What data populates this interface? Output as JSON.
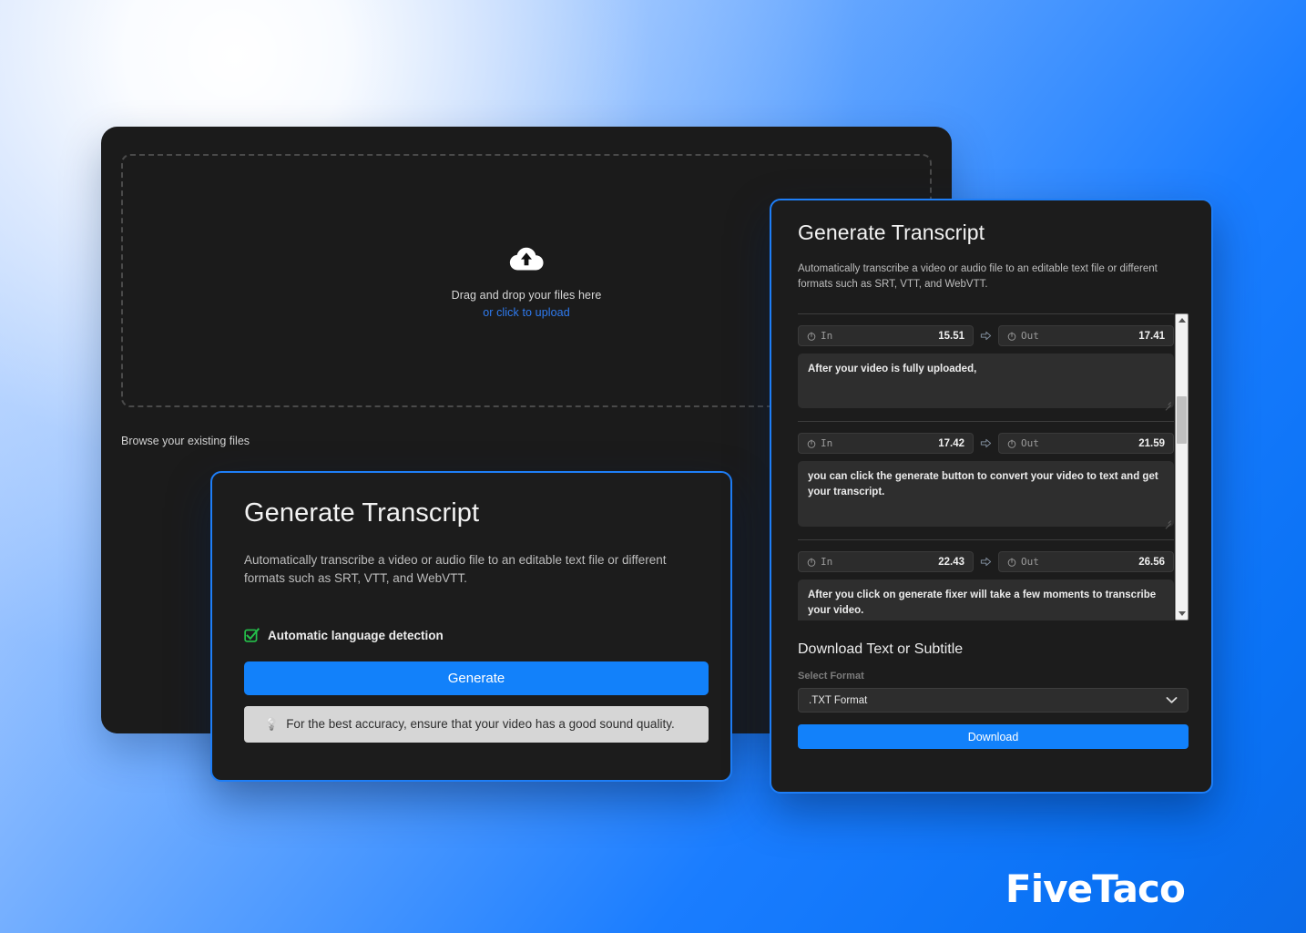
{
  "brand": {
    "name": "FiveTaco"
  },
  "upload_panel": {
    "dropzone": {
      "icon": "cloud-upload-icon",
      "line1": "Drag and drop your files here",
      "link": "or click to upload"
    },
    "browse_label": "Browse your existing files"
  },
  "front_card": {
    "title": "Generate Transcript",
    "description": "Automatically transcribe a video or audio file to an editable text file or different formats such as SRT, VTT, and WebVTT.",
    "auto_language": {
      "icon": "checkbox-checked-icon",
      "label": "Automatic language detection",
      "checked": true
    },
    "generate_label": "Generate",
    "tip": {
      "icon": "lightbulb-icon",
      "text": "For the best accuracy, ensure that your video has a good sound quality."
    },
    "accent_color": "#1281fa",
    "check_color": "#24c04a"
  },
  "right_card": {
    "title": "Generate Transcript",
    "description": "Automatically transcribe a video or audio file to an editable text file or different formats such as SRT, VTT, and WebVTT.",
    "time_labels": {
      "in": "In",
      "out": "Out"
    },
    "segments": [
      {
        "in": "15.51",
        "out": "17.41",
        "text": "After your video is fully uploaded,"
      },
      {
        "in": "17.42",
        "out": "21.59",
        "text": "you can click the generate button to convert your video to text and get your transcript."
      },
      {
        "in": "22.43",
        "out": "26.56",
        "text": "After you click on generate fixer will take a few moments to transcribe your video."
      }
    ],
    "download": {
      "heading": "Download Text or Subtitle",
      "select_label": "Select Format",
      "selected_format": ".TXT Format",
      "button_label": "Download"
    },
    "border_color": "#1e7ef7",
    "accent_color": "#1281fa"
  }
}
